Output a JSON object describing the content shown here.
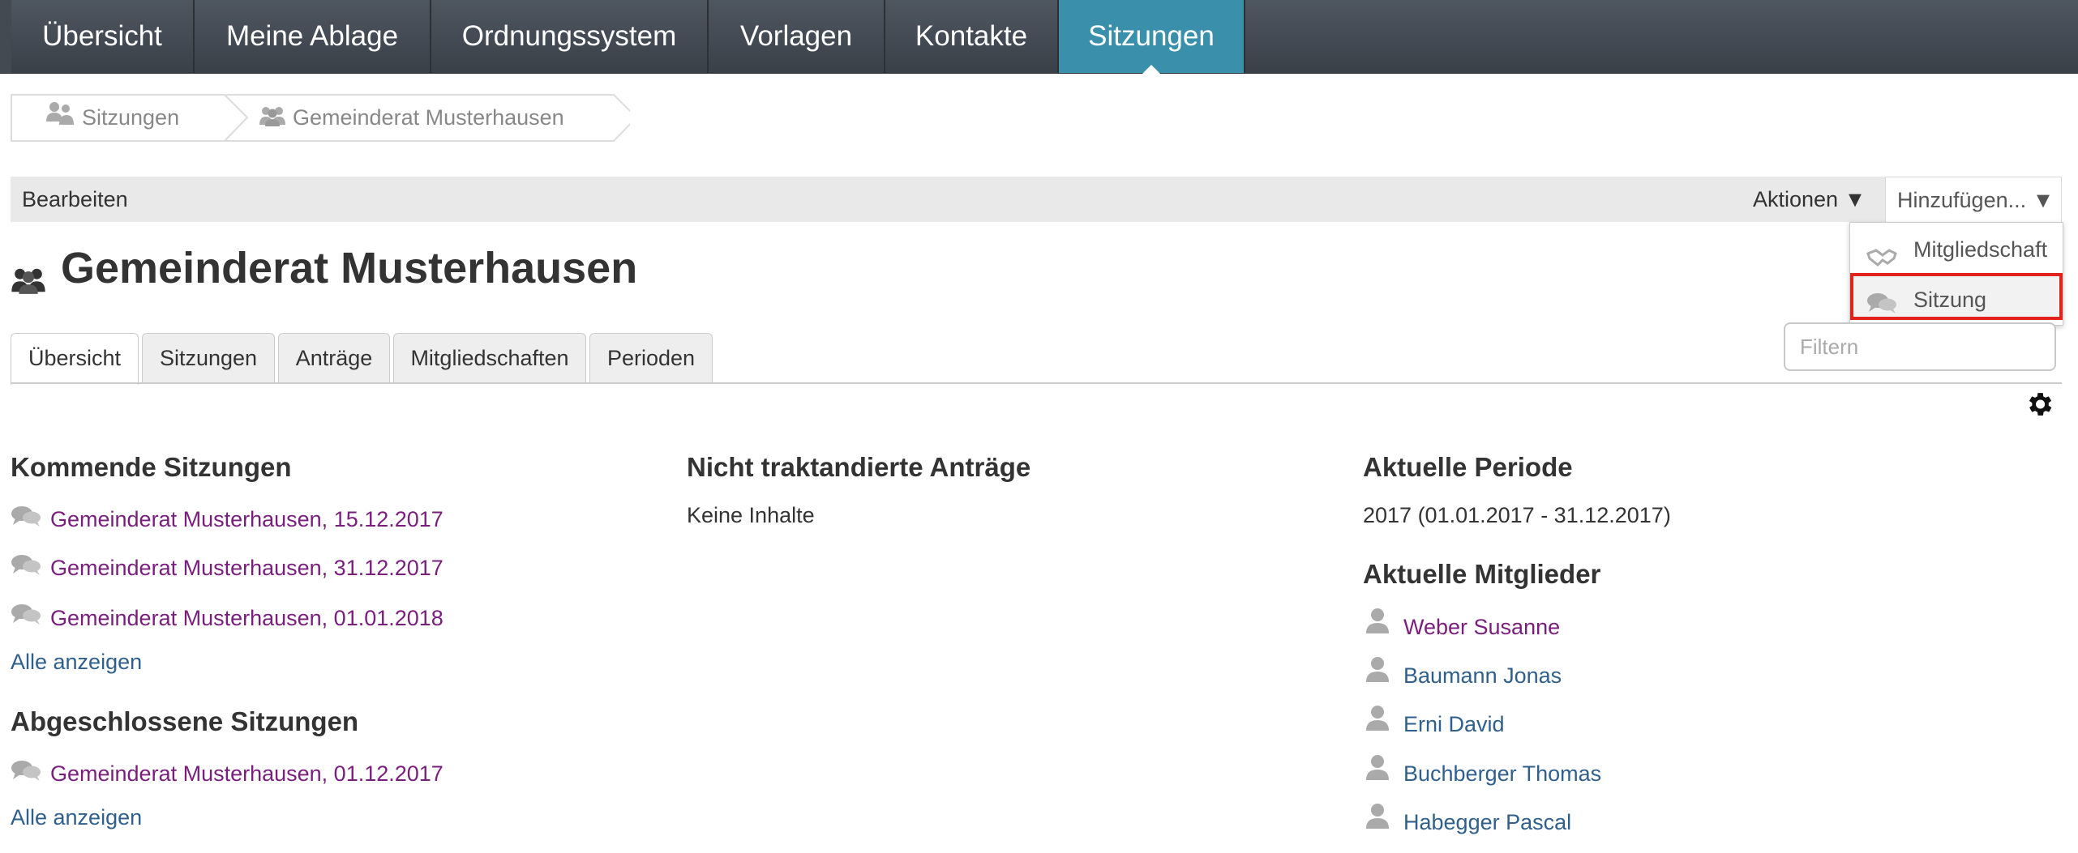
{
  "nav": {
    "items": [
      {
        "label": "Übersicht"
      },
      {
        "label": "Meine Ablage"
      },
      {
        "label": "Ordnungssystem"
      },
      {
        "label": "Vorlagen"
      },
      {
        "label": "Kontakte"
      },
      {
        "label": "Sitzungen",
        "active": true
      }
    ]
  },
  "breadcrumb": {
    "items": [
      {
        "label": "Sitzungen",
        "icon": "committee-container-icon"
      },
      {
        "label": "Gemeinderat Musterhausen",
        "icon": "group-icon"
      }
    ]
  },
  "toolbar": {
    "edit_label": "Bearbeiten",
    "actions_label": "Aktionen ▼",
    "add_label": "Hinzufügen... ▼"
  },
  "add_menu": {
    "items": [
      {
        "label": "Mitgliedschaft",
        "icon": "handshake-icon"
      },
      {
        "label": "Sitzung",
        "icon": "speech-bubbles-icon",
        "highlighted": true
      }
    ]
  },
  "page": {
    "title": "Gemeinderat Musterhausen",
    "title_icon": "group-icon"
  },
  "tabs": [
    {
      "label": "Übersicht",
      "active": true
    },
    {
      "label": "Sitzungen"
    },
    {
      "label": "Anträge"
    },
    {
      "label": "Mitgliedschaften"
    },
    {
      "label": "Perioden"
    }
  ],
  "filter": {
    "placeholder": "Filtern"
  },
  "upcoming": {
    "heading": "Kommende Sitzungen",
    "items": [
      "Gemeinderat Musterhausen, 15.12.2017",
      "Gemeinderat Musterhausen, 31.12.2017",
      "Gemeinderat Musterhausen, 01.01.2018"
    ],
    "show_all": "Alle anzeigen"
  },
  "closed": {
    "heading": "Abgeschlossene Sitzungen",
    "items": [
      "Gemeinderat Musterhausen, 01.12.2017"
    ],
    "show_all": "Alle anzeigen"
  },
  "proposals": {
    "heading": "Nicht traktandierte Anträge",
    "empty": "Keine Inhalte"
  },
  "period": {
    "heading": "Aktuelle Periode",
    "value": "2017 (01.01.2017 - 31.12.2017)"
  },
  "members": {
    "heading": "Aktuelle Mitglieder",
    "items": [
      {
        "name": "Weber Susanne",
        "visited": true
      },
      {
        "name": "Baumann Jonas"
      },
      {
        "name": "Erni David"
      },
      {
        "name": "Buchberger Thomas"
      },
      {
        "name": "Habegger Pascal"
      }
    ]
  },
  "colors": {
    "nav_bg": "#454c54",
    "nav_active": "#3a8fab",
    "visited_link": "#7a1e7e",
    "link": "#2f5f8c",
    "highlight_border": "#e0241b"
  }
}
